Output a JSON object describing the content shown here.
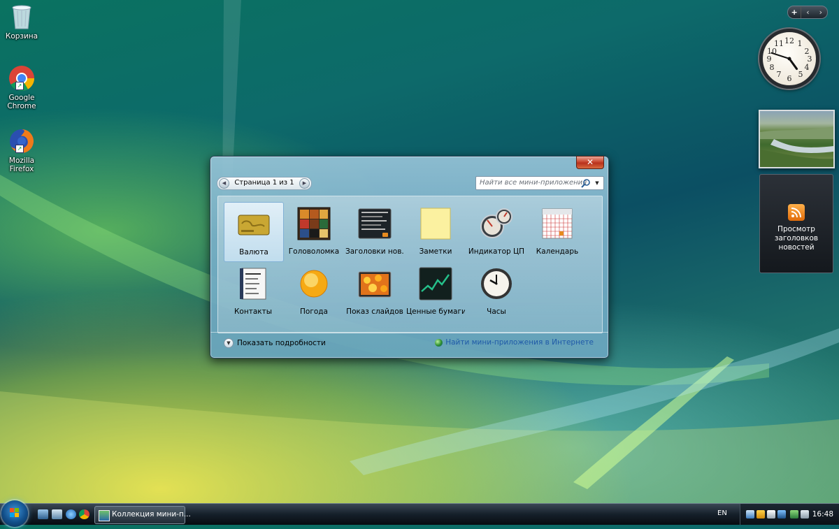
{
  "desktop": {
    "icons": [
      {
        "label": "Корзина",
        "icon": "recycle-bin-icon"
      },
      {
        "label": "Google Chrome",
        "icon": "chrome-icon"
      },
      {
        "label": "Mozilla Firefox",
        "icon": "firefox-icon"
      }
    ]
  },
  "sidebar": {
    "controls": {
      "add": "+",
      "prev": "‹",
      "next": "›"
    },
    "clock": {
      "hour": 4,
      "minute": 48
    },
    "feed_title": "Просмотр заголовков новостей"
  },
  "gallery": {
    "close_label": "✕",
    "page_label": "Страница 1 из 1",
    "search_placeholder": "Найти все мини-приложения",
    "gadgets": [
      {
        "name": "Валюта",
        "icon": "currency-icon",
        "selected": true
      },
      {
        "name": "Головоломка",
        "icon": "puzzle-icon",
        "selected": false
      },
      {
        "name": "Заголовки нов...",
        "icon": "headlines-icon",
        "selected": false
      },
      {
        "name": "Заметки",
        "icon": "notes-icon",
        "selected": false
      },
      {
        "name": "Индикатор ЦП",
        "icon": "cpu-meter-icon",
        "selected": false
      },
      {
        "name": "Календарь",
        "icon": "calendar-icon",
        "selected": false
      },
      {
        "name": "Контакты",
        "icon": "contacts-icon",
        "selected": false
      },
      {
        "name": "Погода",
        "icon": "weather-icon",
        "selected": false
      },
      {
        "name": "Показ слайдов",
        "icon": "slideshow-icon",
        "selected": false
      },
      {
        "name": "Ценные бумаги",
        "icon": "stocks-icon",
        "selected": false
      },
      {
        "name": "Часы",
        "icon": "clock-icon",
        "selected": false
      }
    ],
    "show_details": "Показать подробности",
    "online_link": "Найти мини-приложения в Интернете"
  },
  "taskbar": {
    "task_label": "Коллекция мини-п...",
    "language": "EN",
    "time": "16:48"
  },
  "colors": {
    "accent": "#1f5aa8",
    "selection": "#c8e2f3"
  }
}
